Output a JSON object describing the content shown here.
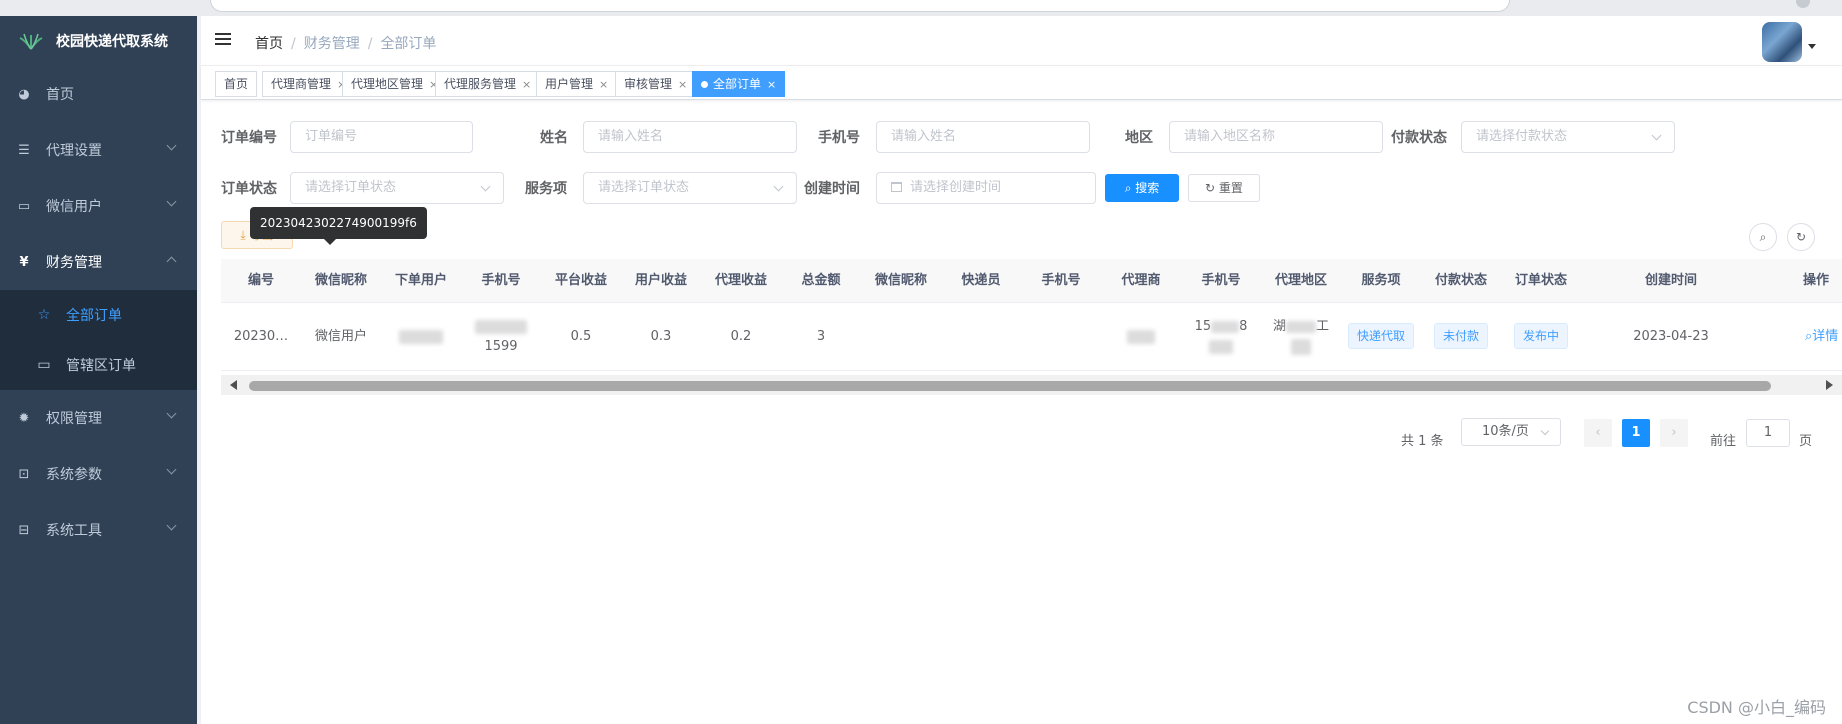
{
  "app": {
    "title": "校园快递代取系统"
  },
  "sidebar": {
    "items": [
      {
        "label": "首页",
        "icon": "dashboard-icon",
        "expandable": false
      },
      {
        "label": "代理设置",
        "icon": "sliders-icon",
        "expandable": true
      },
      {
        "label": "微信用户",
        "icon": "monitor-icon",
        "expandable": true
      },
      {
        "label": "财务管理",
        "icon": "yen-icon",
        "expandable": true,
        "expanded": true,
        "children": [
          {
            "label": "全部订单",
            "icon": "star-icon",
            "active": true
          },
          {
            "label": "管辖区订单",
            "icon": "monitor-icon",
            "active": false
          }
        ]
      },
      {
        "label": "权限管理",
        "icon": "gear-icon",
        "expandable": true
      },
      {
        "label": "系统参数",
        "icon": "chart-icon",
        "expandable": true
      },
      {
        "label": "系统工具",
        "icon": "toolbox-icon",
        "expandable": true
      }
    ]
  },
  "header": {
    "breadcrumb": [
      "首页",
      "财务管理",
      "全部订单"
    ]
  },
  "tags": [
    {
      "label": "首页",
      "closable": false,
      "active": false
    },
    {
      "label": "代理商管理",
      "closable": true,
      "active": false
    },
    {
      "label": "代理地区管理",
      "closable": true,
      "active": false
    },
    {
      "label": "代理服务管理",
      "closable": true,
      "active": false
    },
    {
      "label": "用户管理",
      "closable": true,
      "active": false
    },
    {
      "label": "审核管理",
      "closable": true,
      "active": false
    },
    {
      "label": "全部订单",
      "closable": true,
      "active": true
    }
  ],
  "filters": {
    "order_no": {
      "label": "订单编号",
      "placeholder": "订单编号"
    },
    "name": {
      "label": "姓名",
      "placeholder": "请输入姓名"
    },
    "phone": {
      "label": "手机号",
      "placeholder": "请输入姓名"
    },
    "region": {
      "label": "地区",
      "placeholder": "请输入地区名称"
    },
    "pay_status": {
      "label": "付款状态",
      "placeholder": "请选择付款状态"
    },
    "order_status": {
      "label": "订单状态",
      "placeholder": "请选择订单状态"
    },
    "service": {
      "label": "服务项",
      "placeholder": "请选择订单状态"
    },
    "created": {
      "label": "创建时间",
      "placeholder": "请选择创建时间"
    },
    "search_label": "搜索",
    "reset_label": "重置"
  },
  "toolbar": {
    "export_label": "导出",
    "tooltip": "20230423022749001​99f6"
  },
  "table": {
    "columns": [
      "编号",
      "微信昵称",
      "下单用户",
      "手机号",
      "平台收益",
      "用户收益",
      "代理收益",
      "总金额",
      "微信昵称",
      "快递员",
      "手机号",
      "代理商",
      "手机号",
      "代理地区",
      "服务项",
      "付款状态",
      "订单状态",
      "创建时间",
      "操作"
    ],
    "rows": [
      {
        "id": "20230…",
        "wx_nickname": "微信用户",
        "phone_tail": "1599",
        "platform_income": "0.5",
        "user_income": "0.3",
        "agent_income": "0.2",
        "total": "3",
        "agent_phone_head": "15",
        "agent_phone_mid": "8",
        "region": "湖",
        "region_tail": "工",
        "service": "快递代取",
        "pay_status": "未付款",
        "order_status": "发布中",
        "created": "2023-04-23",
        "action": "详情"
      }
    ]
  },
  "pagination": {
    "total_text": "共 1 条",
    "page_size": "10条/页",
    "current": "1",
    "goto_prefix": "前往",
    "goto_value": "1",
    "goto_suffix": "页",
    "prev": "‹",
    "next": "›"
  },
  "watermark": "CSDN @小白_编码"
}
